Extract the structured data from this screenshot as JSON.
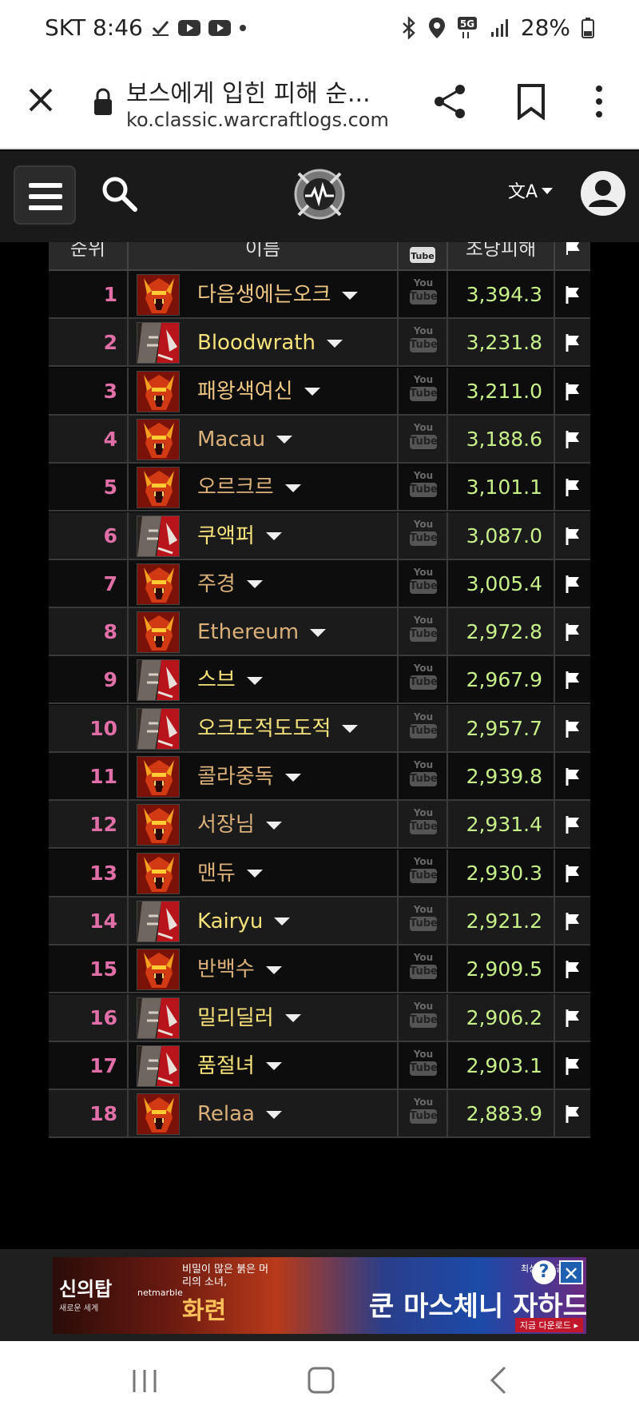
{
  "status_bar": {
    "carrier_time": "SKT 8:46",
    "battery": "28%",
    "icons": [
      "check-icon",
      "youtube-icon",
      "youtube-icon",
      "dot-icon",
      "bluetooth-icon",
      "location-icon",
      "5g-icon",
      "signal-icon",
      "battery-icon"
    ]
  },
  "browser": {
    "page_title": "보스에게 입힌 피해 순...",
    "url": "ko.classic.warcraftlogs.com"
  },
  "table": {
    "headers": [
      "순위",
      "이름",
      "YouTube",
      "초당피해",
      "flag"
    ],
    "rows": [
      {
        "rank": "1",
        "name": "다음생에는오크",
        "dps": "3,394.3",
        "avatar": "orc",
        "name_color": "#f0c886"
      },
      {
        "rank": "2",
        "name": "Bloodwrath",
        "dps": "3,231.8",
        "avatar": "human",
        "name_color": "#f5e27a"
      },
      {
        "rank": "3",
        "name": "패왕색여신",
        "dps": "3,211.0",
        "avatar": "orc",
        "name_color": "#f0c886"
      },
      {
        "rank": "4",
        "name": "Macau",
        "dps": "3,188.6",
        "avatar": "orc",
        "name_color": "#d9b07a"
      },
      {
        "rank": "5",
        "name": "오르크르",
        "dps": "3,101.1",
        "avatar": "orc",
        "name_color": "#d9b07a"
      },
      {
        "rank": "6",
        "name": "쿠액퍼",
        "dps": "3,087.0",
        "avatar": "human",
        "name_color": "#f5e27a"
      },
      {
        "rank": "7",
        "name": "주경",
        "dps": "3,005.4",
        "avatar": "orc",
        "name_color": "#d9b07a"
      },
      {
        "rank": "8",
        "name": "Ethereum",
        "dps": "2,972.8",
        "avatar": "orc",
        "name_color": "#d9b07a"
      },
      {
        "rank": "9",
        "name": "스브",
        "dps": "2,967.9",
        "avatar": "human",
        "name_color": "#f5e27a"
      },
      {
        "rank": "10",
        "name": "오크도적도도적",
        "dps": "2,957.7",
        "avatar": "human",
        "name_color": "#f5e27a"
      },
      {
        "rank": "11",
        "name": "콜라중독",
        "dps": "2,939.8",
        "avatar": "orc",
        "name_color": "#d9b07a"
      },
      {
        "rank": "12",
        "name": "서장님",
        "dps": "2,931.4",
        "avatar": "orc",
        "name_color": "#d9b07a"
      },
      {
        "rank": "13",
        "name": "맨듀",
        "dps": "2,930.3",
        "avatar": "orc",
        "name_color": "#d9b07a"
      },
      {
        "rank": "14",
        "name": "Kairyu",
        "dps": "2,921.2",
        "avatar": "human",
        "name_color": "#f5e27a"
      },
      {
        "rank": "15",
        "name": "반백수",
        "dps": "2,909.5",
        "avatar": "orc",
        "name_color": "#d9b07a"
      },
      {
        "rank": "16",
        "name": "밀리딜러",
        "dps": "2,906.2",
        "avatar": "human",
        "name_color": "#f5e27a"
      },
      {
        "rank": "17",
        "name": "품절녀",
        "dps": "2,903.1",
        "avatar": "human",
        "name_color": "#f5e27a"
      },
      {
        "rank": "18",
        "name": "Relaa",
        "dps": "2,883.9",
        "avatar": "orc",
        "name_color": "#d9b07a"
      }
    ],
    "youtube_you": "You",
    "youtube_tube": "Tube"
  },
  "ad": {
    "logo": "신의탑",
    "logo_sub": "새로운 세계",
    "brand": "netmarble",
    "sub_text": "비밀이 많은 붉은 머리의 소녀,",
    "hero": "화련",
    "tag": "최상위의 공주,",
    "main": "쿤 마스체니 자하드",
    "download": "지금 다운로드 ▸",
    "q": "?",
    "x": "✕"
  }
}
